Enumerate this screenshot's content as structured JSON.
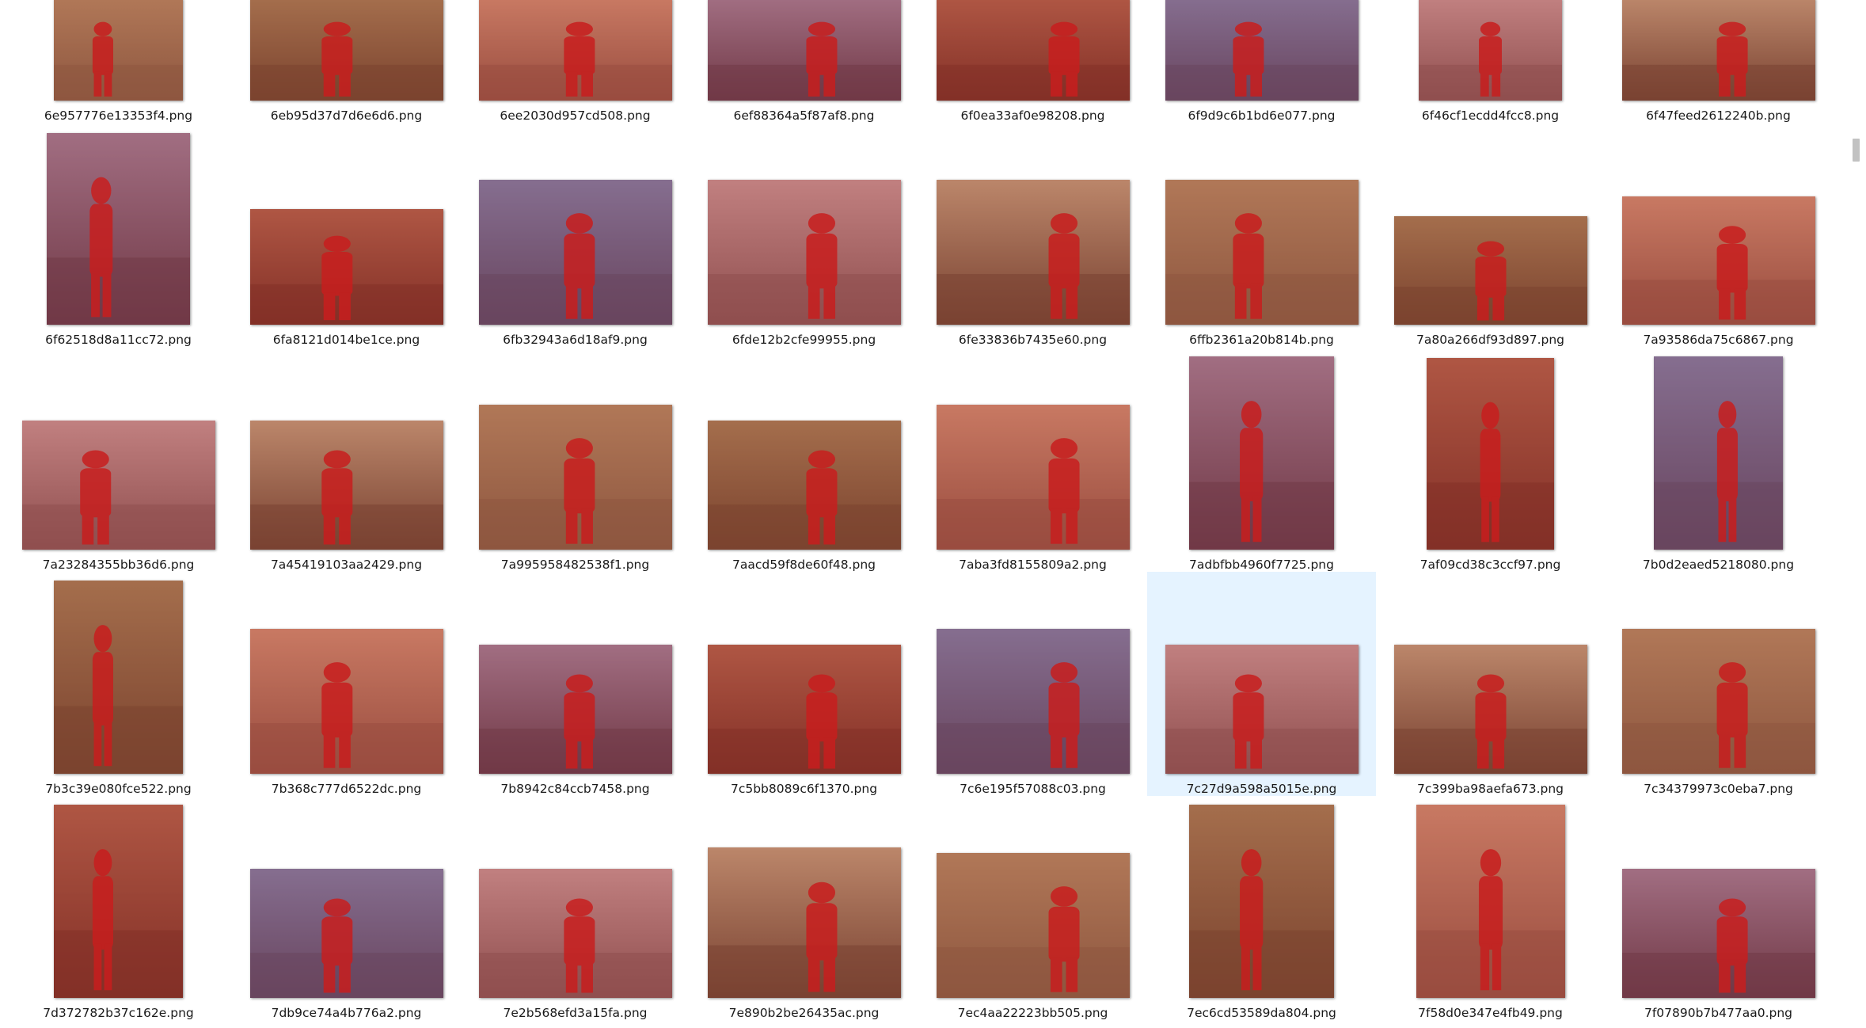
{
  "rows": [
    {
      "items": [
        {
          "name": "6e957776e13353f4.png",
          "w": 163,
          "h": 129,
          "mb": 128
        },
        {
          "name": "6eb95d37d7d6e6d6.png",
          "w": 244,
          "h": 129,
          "mb": 128
        },
        {
          "name": "6ee2030d957cd508.png",
          "w": 244,
          "h": 129,
          "mb": 128
        },
        {
          "name": "6ef88364a5f87af8.png",
          "w": 244,
          "h": 129,
          "mb": 128
        },
        {
          "name": "6f0ea33af0e98208.png",
          "w": 244,
          "h": 129,
          "mb": 128
        },
        {
          "name": "6f9d9c6b1bd6e077.png",
          "w": 244,
          "h": 129,
          "mb": 128
        },
        {
          "name": "6f46cf1ecdd4fcc8.png",
          "w": 181,
          "h": 129,
          "mb": 128
        },
        {
          "name": "6f47feed2612240b.png",
          "w": 244,
          "h": 129,
          "mb": 128
        }
      ]
    },
    {
      "items": [
        {
          "name": "6f62518d8a11cc72.png",
          "w": 181,
          "h": 242
        },
        {
          "name": "6fa8121d014be1ce.png",
          "w": 244,
          "h": 146
        },
        {
          "name": "6fb32943a6d18af9.png",
          "w": 244,
          "h": 183
        },
        {
          "name": "6fde12b2cfe99955.png",
          "w": 244,
          "h": 183
        },
        {
          "name": "6fe33836b7435e60.png",
          "w": 244,
          "h": 183
        },
        {
          "name": "6ffb2361a20b814b.png",
          "w": 244,
          "h": 183
        },
        {
          "name": "7a80a266df93d897.png",
          "w": 244,
          "h": 137
        },
        {
          "name": "7a93586da75c6867.png",
          "w": 244,
          "h": 162
        }
      ]
    },
    {
      "items": [
        {
          "name": "7a23284355bb36d6.png",
          "w": 244,
          "h": 163
        },
        {
          "name": "7a45419103aa2429.png",
          "w": 244,
          "h": 163
        },
        {
          "name": "7a995958482538f1.png",
          "w": 244,
          "h": 183
        },
        {
          "name": "7aacd59f8de60f48.png",
          "w": 244,
          "h": 163
        },
        {
          "name": "7aba3fd8155809a2.png",
          "w": 244,
          "h": 183
        },
        {
          "name": "7adbfbb4960f7725.png",
          "w": 183,
          "h": 244
        },
        {
          "name": "7af09cd38c3ccf97.png",
          "w": 161,
          "h": 242
        },
        {
          "name": "7b0d2eaed5218080.png",
          "w": 163,
          "h": 244
        }
      ]
    },
    {
      "items": [
        {
          "name": "7b3c39e080fce522.png",
          "w": 163,
          "h": 244
        },
        {
          "name": "7b368c777d6522dc.png",
          "w": 244,
          "h": 183
        },
        {
          "name": "7b8942c84ccb7458.png",
          "w": 244,
          "h": 163
        },
        {
          "name": "7c5bb8089c6f1370.png",
          "w": 244,
          "h": 163
        },
        {
          "name": "7c6e195f57088c03.png",
          "w": 244,
          "h": 183
        },
        {
          "name": "7c27d9a598a5015e.png",
          "w": 244,
          "h": 163,
          "selected": true
        },
        {
          "name": "7c399ba98aefa673.png",
          "w": 244,
          "h": 163
        },
        {
          "name": "7c34379973c0eba7.png",
          "w": 244,
          "h": 183
        }
      ]
    },
    {
      "items": [
        {
          "name": "7d372782b37c162e.png",
          "w": 163,
          "h": 244
        },
        {
          "name": "7db9ce74a4b776a2.png",
          "w": 244,
          "h": 163
        },
        {
          "name": "7e2b568efd3a15fa.png",
          "w": 244,
          "h": 163
        },
        {
          "name": "7e890b2be26435ac.png",
          "w": 244,
          "h": 190
        },
        {
          "name": "7ec4aa22223bb505.png",
          "w": 244,
          "h": 183
        },
        {
          "name": "7ec6cd53589da804.png",
          "w": 183,
          "h": 244
        },
        {
          "name": "7f58d0e347e4fb49.png",
          "w": 188,
          "h": 244
        },
        {
          "name": "7f07890b7b477aa0.png",
          "w": 244,
          "h": 163
        }
      ]
    }
  ],
  "colors": {
    "selection": "#e5f3ff",
    "overlay_red": "#c81e1e",
    "label_text": "#1a1a1a",
    "scroll_thumb": "#c2c2c2"
  },
  "scrollbar": {
    "position_fraction": 0.14
  }
}
